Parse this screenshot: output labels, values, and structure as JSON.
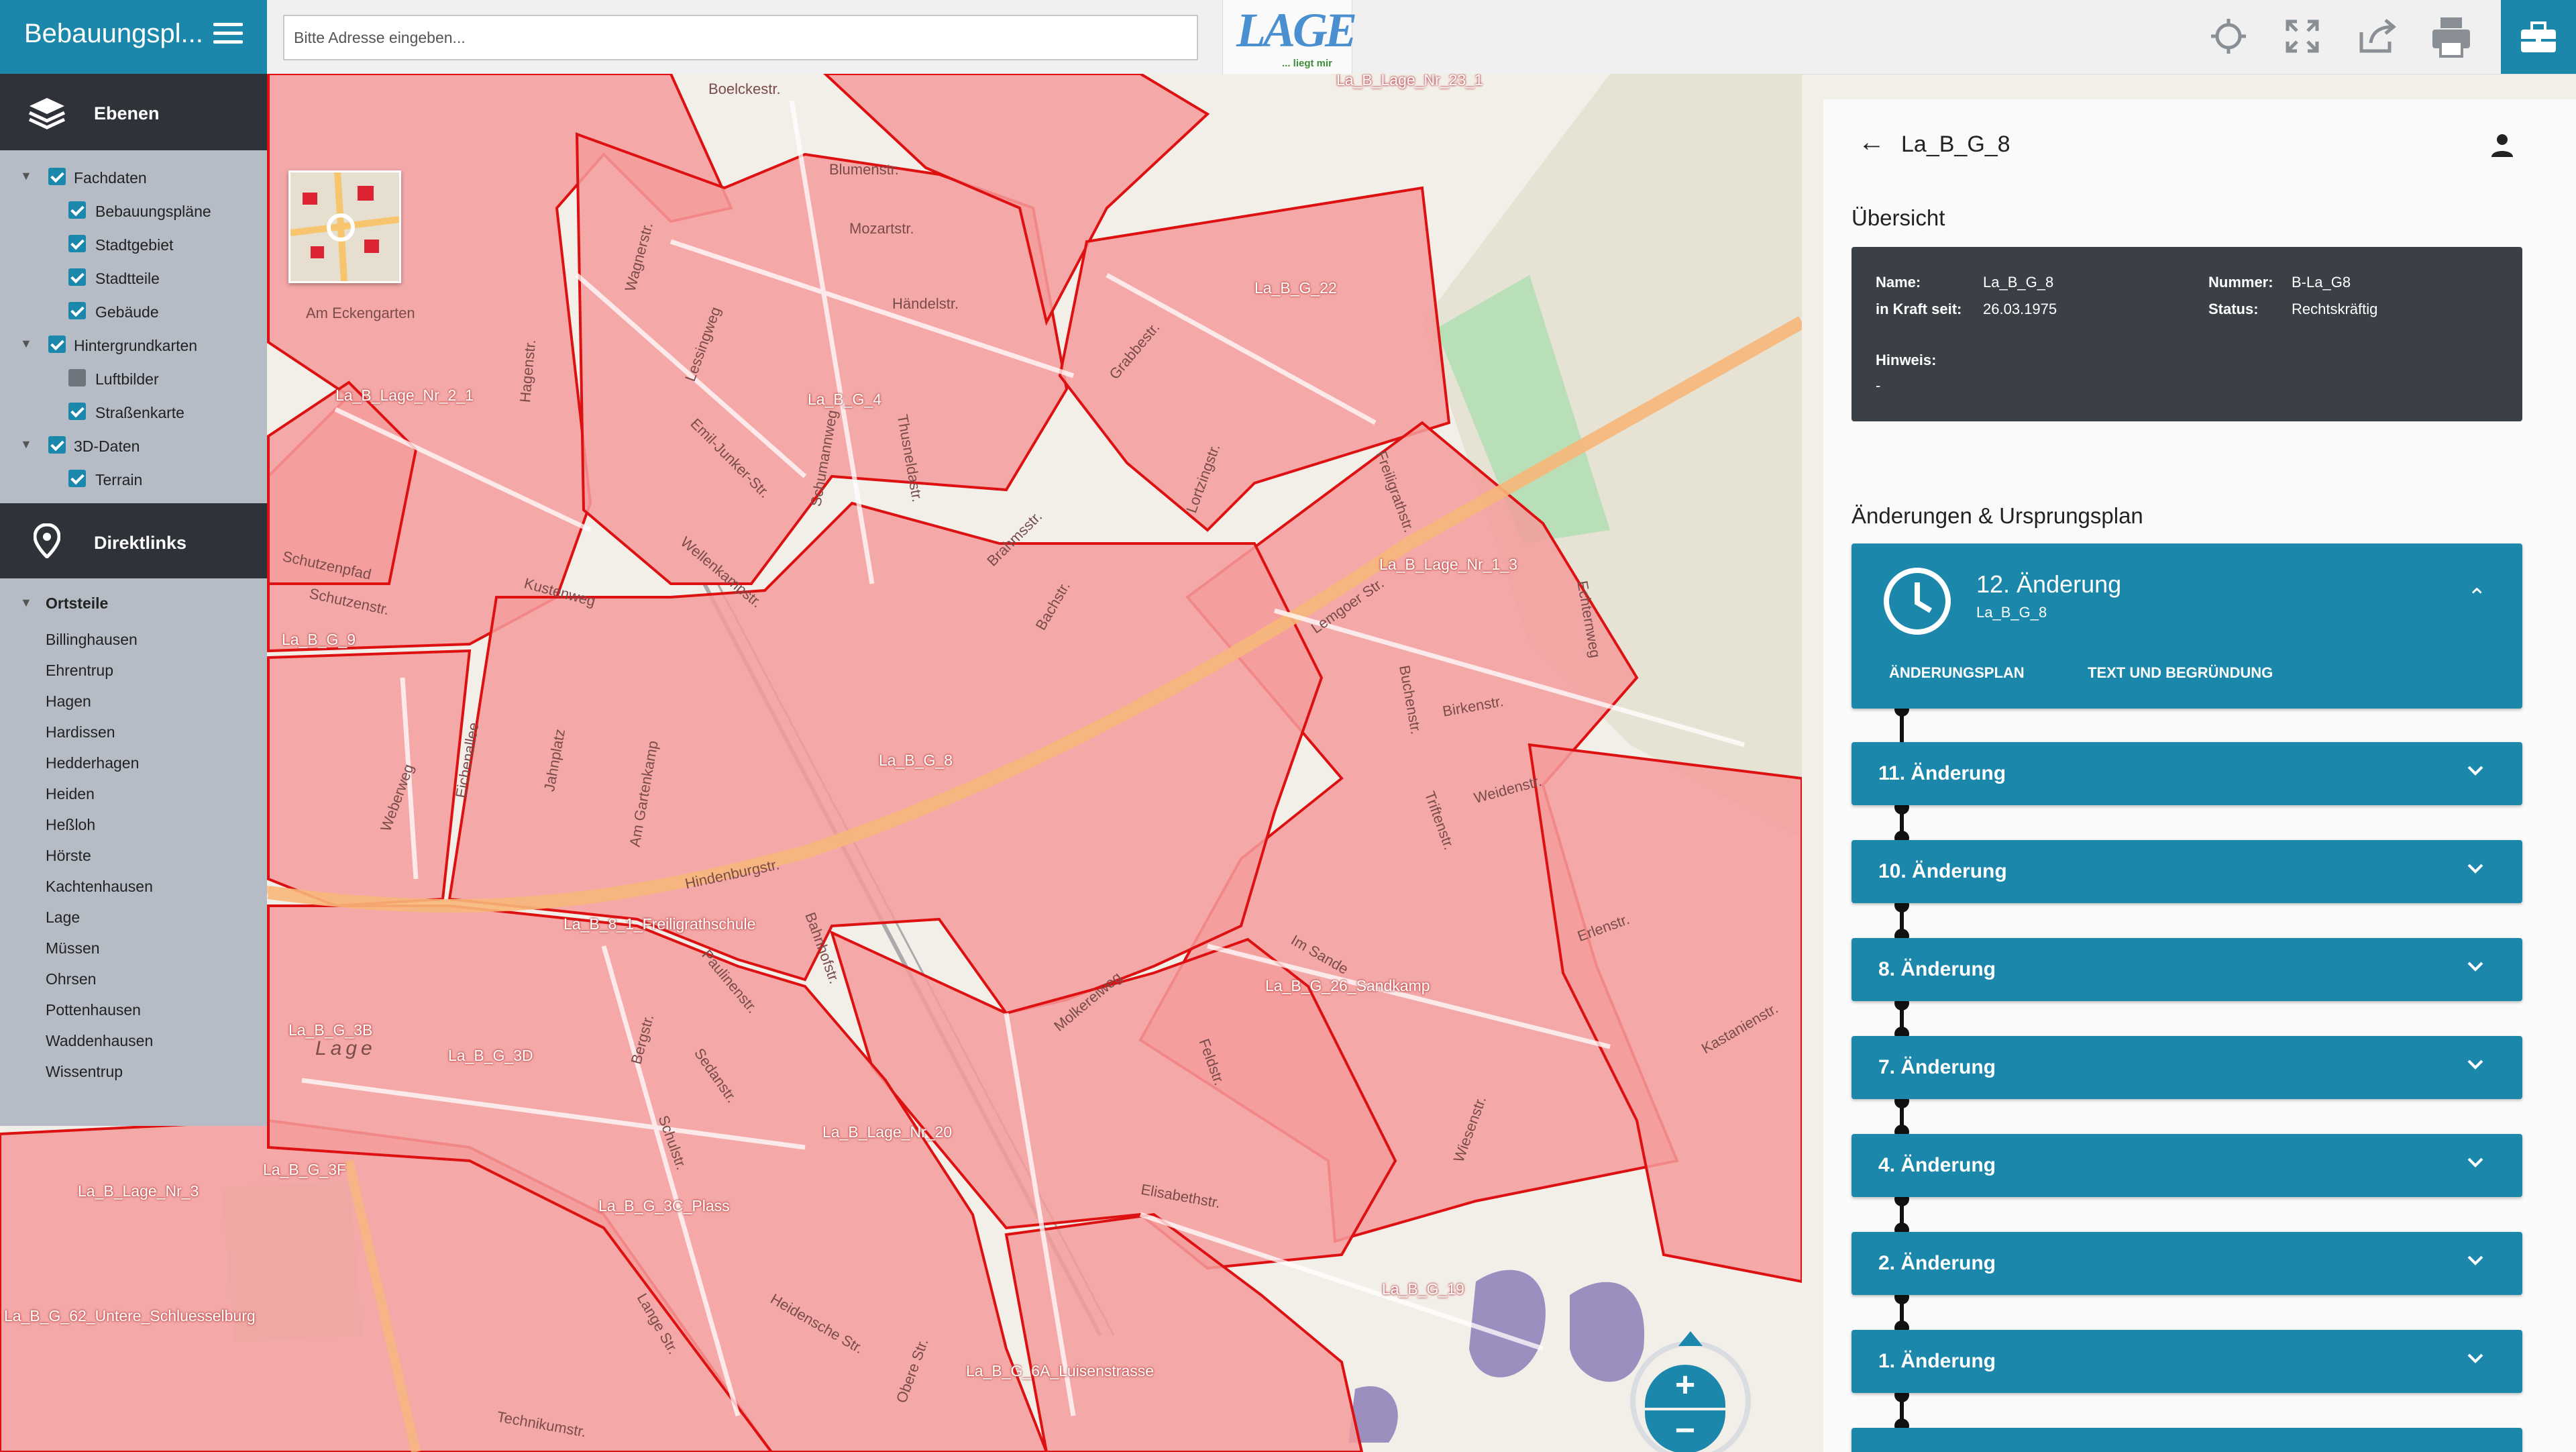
{
  "header": {
    "app_title": "Bebauungspl...",
    "search_placeholder": "Bitte Adresse eingeben...",
    "logo_text": "LAGE",
    "logo_tagline": "... liegt mir",
    "icons": [
      "crosshair-icon",
      "fullscreen-icon",
      "share-icon",
      "print-icon",
      "toolbox-icon"
    ],
    "accent_color": "#1b87ab"
  },
  "layers": {
    "title": "Ebenen",
    "items": [
      {
        "label": "Fachdaten",
        "checked": true,
        "level": 0,
        "expandable": true
      },
      {
        "label": "Bebauungspläne",
        "checked": true,
        "level": 1
      },
      {
        "label": "Stadtgebiet",
        "checked": true,
        "level": 1
      },
      {
        "label": "Stadtteile",
        "checked": true,
        "level": 1
      },
      {
        "label": "Gebäude",
        "checked": true,
        "level": 1
      },
      {
        "label": "Hintergrundkarten",
        "checked": true,
        "level": 0,
        "expandable": true
      },
      {
        "label": "Luftbilder",
        "checked": false,
        "level": 1
      },
      {
        "label": "Straßenkarte",
        "checked": true,
        "level": 1
      },
      {
        "label": "3D-Daten",
        "checked": true,
        "level": 0,
        "expandable": true
      },
      {
        "label": "Terrain",
        "checked": true,
        "level": 1
      }
    ]
  },
  "direktlinks": {
    "title": "Direktlinks",
    "group": "Ortsteile",
    "places": [
      "Billinghausen",
      "Ehrentrup",
      "Hagen",
      "Hardissen",
      "Hedderhagen",
      "Heiden",
      "Heßloh",
      "Hörste",
      "Kachtenhausen",
      "Lage",
      "Müssen",
      "Ohrsen",
      "Pottenhausen",
      "Waddenhausen",
      "Wissentrup"
    ]
  },
  "map": {
    "plan_labels": [
      "La_B_Lage_Nr_23_1",
      "La_B_G_22",
      "La_B_Lage_Nr_2_1",
      "La_B_G_4",
      "La_B_Lage_Nr_1_3",
      "La_B_G_9",
      "La_B_G_8",
      "La_B_G_26_Sandkamp",
      "La_B_G_3B",
      "La_B_G_3D",
      "La_B_Lage_Nr_20",
      "La_B_Lage_Nr_3",
      "La_B_G_3F",
      "La_B_G_3C_Plass",
      "La_B_G_19",
      "La_B_G_62_Untere_Schluesselburg",
      "La_B_G_6A_Luisenstrasse",
      "La_B_8_1_Freiligrathschule"
    ],
    "street_labels": [
      "Boelckestr.",
      "Blumenstr.",
      "Mozartstr.",
      "Händelstr.",
      "Lessingweg",
      "Wagnerstr.",
      "Emil-Junker-Str.",
      "Schumannweg",
      "Thusneldastr.",
      "Wellenkampstr.",
      "Brahmsstr.",
      "Bachstr.",
      "Lortzingstr.",
      "Grabbestr.",
      "Freiligrathstr.",
      "Lemgoer Str.",
      "Hindenburgstr.",
      "Schutzenpfad",
      "Schutzenstr.",
      "Weberweg",
      "Eichenallee",
      "Birkenstr.",
      "Buchenstr.",
      "Weidenstr.",
      "Erlenstr.",
      "Kastanienstr.",
      "Elisabethstr.",
      "Molkereiweg",
      "Paulinenstr.",
      "Sedanstr.",
      "Bergstr.",
      "Schulstr.",
      "Heidensche Str.",
      "Technikumstr.",
      "Lange Str.",
      "Obere Str.",
      "Am Eckengarten",
      "Kustenweg",
      "Hagenstr.",
      "Echternweg",
      "Im Sande",
      "Am Gartenkamp",
      "Jahnplatz",
      "Bahnhofstr.",
      "Triftenstr.",
      "Feldstr.",
      "Wiesenstr.",
      "Lage"
    ],
    "zoom_in": "+",
    "zoom_out": "−"
  },
  "detail": {
    "plan_id": "La_B_G_8",
    "overview_title": "Übersicht",
    "fields": {
      "name_label": "Name:",
      "name_value": "La_B_G_8",
      "nummer_label": "Nummer:",
      "nummer_value": "B-La_G8",
      "inkraft_label": "in Kraft seit:",
      "inkraft_value": "26.03.1975",
      "status_label": "Status:",
      "status_value": "Rechtskräftig",
      "hinweis_label": "Hinweis:",
      "hinweis_value": "-"
    },
    "changes_title": "Änderungen & Ursprungsplan",
    "current_change": {
      "title": "12. Änderung",
      "subtitle": "La_B_G_8",
      "link1": "ÄNDERUNGSPLAN",
      "link2": "TEXT UND BEGRÜNDUNG"
    },
    "changes": [
      "11. Änderung",
      "10. Änderung",
      "8. Änderung",
      "7. Änderung",
      "4. Änderung",
      "2. Änderung",
      "1. Änderung"
    ]
  }
}
